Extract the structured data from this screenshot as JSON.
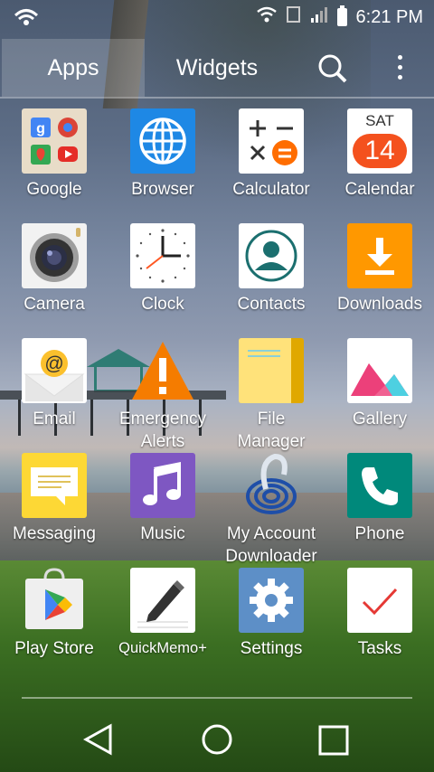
{
  "status_bar": {
    "time": "6:21 PM",
    "icons": [
      "wifi-calling-icon",
      "wifi-icon",
      "sim-icon",
      "signal-icon",
      "battery-icon"
    ]
  },
  "tabs": {
    "apps": "Apps",
    "widgets": "Widgets",
    "active": "Apps"
  },
  "header_actions": [
    "search-icon",
    "overflow-menu-icon"
  ],
  "apps": [
    {
      "label": "Google"
    },
    {
      "label": "Browser"
    },
    {
      "label": "Calculator"
    },
    {
      "label": "Calendar",
      "icon_day": "SAT",
      "icon_date": "14"
    },
    {
      "label": "Camera"
    },
    {
      "label": "Clock"
    },
    {
      "label": "Contacts"
    },
    {
      "label": "Downloads"
    },
    {
      "label": "Email"
    },
    {
      "label": "Emergency",
      "label2": "Alerts"
    },
    {
      "label": "File",
      "label2": "Manager"
    },
    {
      "label": "Gallery"
    },
    {
      "label": "Messaging"
    },
    {
      "label": "Music"
    },
    {
      "label": "My Account",
      "label2": "Downloader"
    },
    {
      "label": "Phone"
    },
    {
      "label": "Play Store"
    },
    {
      "label": "QuickMemo+"
    },
    {
      "label": "Settings"
    },
    {
      "label": "Tasks"
    }
  ],
  "nav": [
    "back-icon",
    "home-icon",
    "recent-apps-icon"
  ],
  "colors": {
    "browser": "#1e88e5",
    "calculator_accent": "#ff6d00",
    "calendar_badge": "#f4511e",
    "downloads": "#ff9800",
    "emergency": "#f57c00",
    "file_manager": "#fbc02d",
    "messaging": "#fdd835",
    "music": "#7e57c2",
    "phone": "#00897b",
    "settings": "#5d8fc7",
    "tasks_check": "#e53935"
  }
}
